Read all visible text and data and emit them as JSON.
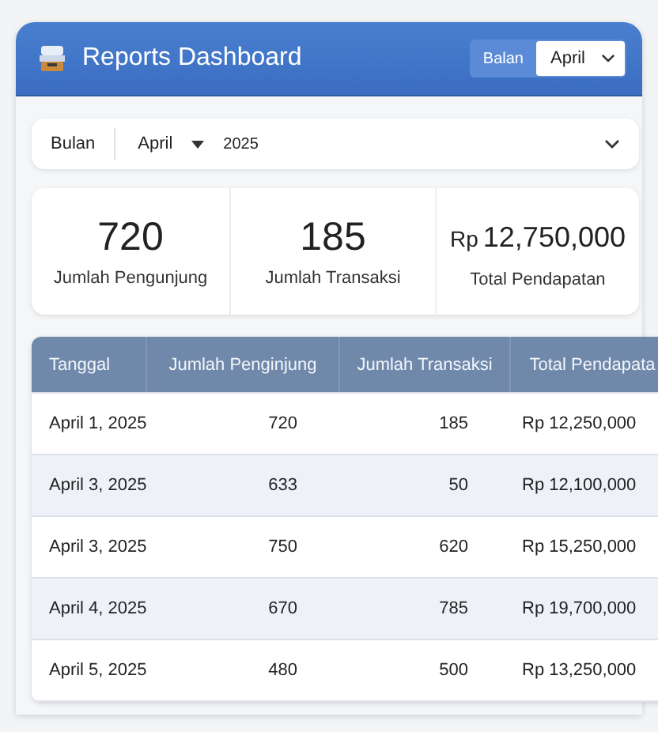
{
  "header": {
    "title": "Reports Dashboard",
    "month_label": "Balan",
    "month_value": "April"
  },
  "filter": {
    "label": "Bulan",
    "month": "April",
    "year": "2025"
  },
  "stats": [
    {
      "value": "720",
      "label": "Jumlah Pengunjung"
    },
    {
      "value": "185",
      "label": "Jumlah Transaksi"
    },
    {
      "prefix": "Rp",
      "value": "12,750,000",
      "label": "Total Pendapatan"
    }
  ],
  "table": {
    "columns": [
      "Tanggal",
      "Jumlah Penginjung",
      "Jumlah Transaksi",
      "Total Pendapata"
    ],
    "rows": [
      [
        "April 1, 2025",
        "720",
        "185",
        "Rp 12,250,000"
      ],
      [
        "April 3, 2025",
        "633",
        "50",
        "Rp 12,100,000"
      ],
      [
        "April 3, 2025",
        "750",
        "620",
        "Rp 15,250,000"
      ],
      [
        "April 4, 2025",
        "670",
        "785",
        "Rp 19,700,000"
      ],
      [
        "April 5, 2025",
        "480",
        "500",
        "Rp 13,250,000"
      ]
    ]
  }
}
